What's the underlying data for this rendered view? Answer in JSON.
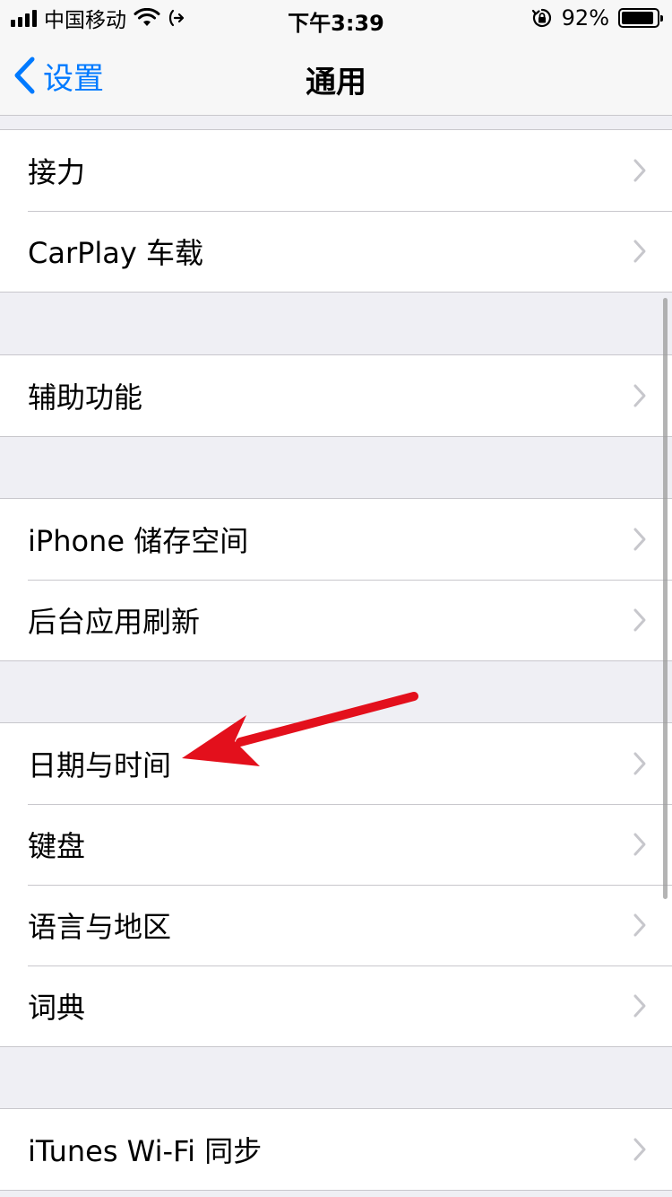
{
  "status_bar": {
    "carrier": "中国移动",
    "time": "下午3:39",
    "battery_percent": "92%",
    "battery_level": 0.92
  },
  "nav": {
    "back_label": "设置",
    "title": "通用"
  },
  "groups": [
    {
      "rows": [
        {
          "label": "接力"
        },
        {
          "label": "CarPlay 车载"
        }
      ]
    },
    {
      "rows": [
        {
          "label": "辅助功能"
        }
      ]
    },
    {
      "rows": [
        {
          "label": "iPhone 储存空间"
        },
        {
          "label": "后台应用刷新"
        }
      ]
    },
    {
      "rows": [
        {
          "label": "日期与时间"
        },
        {
          "label": "键盘"
        },
        {
          "label": "语言与地区"
        },
        {
          "label": "词典"
        }
      ]
    },
    {
      "rows": [
        {
          "label": "iTunes Wi-Fi 同步"
        }
      ]
    }
  ],
  "colors": {
    "accent": "#007aff",
    "annotation_arrow": "#e3101c",
    "chevron": "#c7c7cc"
  }
}
